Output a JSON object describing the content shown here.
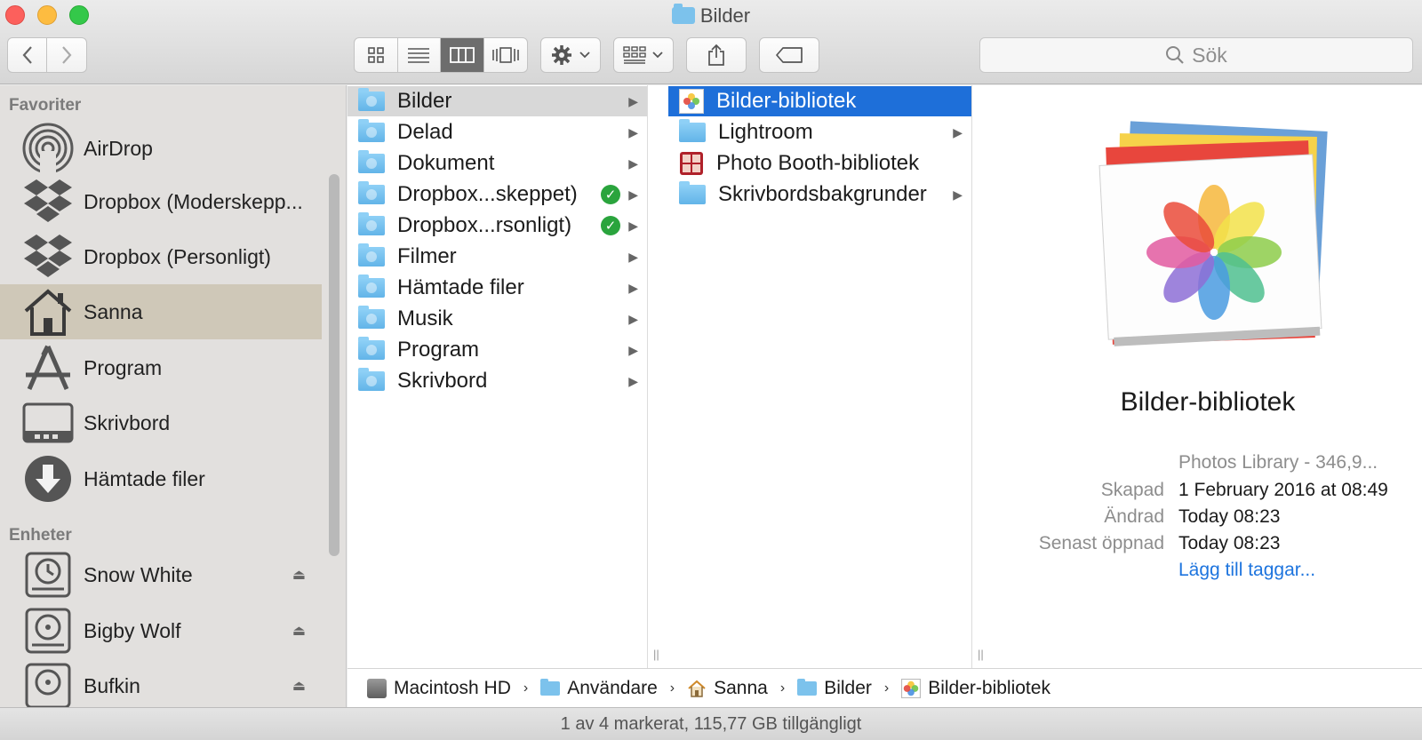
{
  "window": {
    "title": "Bilder"
  },
  "toolbar": {
    "search_placeholder": "Sök"
  },
  "sidebar": {
    "favorites_header": "Favoriter",
    "favorites": [
      {
        "label": "AirDrop",
        "icon": "airdrop-icon"
      },
      {
        "label": "Dropbox (Moderskepp...",
        "icon": "dropbox-icon"
      },
      {
        "label": "Dropbox (Personligt)",
        "icon": "dropbox-icon"
      },
      {
        "label": "Sanna",
        "icon": "home-icon",
        "selected": true
      },
      {
        "label": "Program",
        "icon": "applications-icon"
      },
      {
        "label": "Skrivbord",
        "icon": "desktop-icon"
      },
      {
        "label": "Hämtade filer",
        "icon": "downloads-icon"
      }
    ],
    "devices_header": "Enheter",
    "devices": [
      {
        "label": "Snow White",
        "icon": "time-machine-disk-icon"
      },
      {
        "label": "Bigby Wolf",
        "icon": "disk-icon"
      },
      {
        "label": "Bufkin",
        "icon": "disk-icon"
      }
    ]
  },
  "column1": [
    {
      "label": "Bilder"
    },
    {
      "label": "Delad"
    },
    {
      "label": "Dokument"
    },
    {
      "label": "Dropbox...skeppet)",
      "synced": true
    },
    {
      "label": "Dropbox...rsonligt)",
      "synced": true
    },
    {
      "label": "Filmer"
    },
    {
      "label": "Hämtade filer"
    },
    {
      "label": "Musik"
    },
    {
      "label": "Program"
    },
    {
      "label": "Skrivbord"
    }
  ],
  "column2": [
    {
      "label": "Bilder-bibliotek"
    },
    {
      "label": "Lightroom"
    },
    {
      "label": "Photo Booth-bibliotek"
    },
    {
      "label": "Skrivbordsbakgrunder"
    }
  ],
  "preview": {
    "name": "Bilder-bibliotek",
    "kind": "Photos Library - 346,9...",
    "created_label": "Skapad",
    "created": "1 February 2016 at 08:49",
    "modified_label": "Ändrad",
    "modified": "Today 08:23",
    "opened_label": "Senast öppnad",
    "opened": "Today 08:23",
    "add_tags": "Lägg till taggar..."
  },
  "pathbar": [
    "Macintosh HD",
    "Användare",
    "Sanna",
    "Bilder",
    "Bilder-bibliotek"
  ],
  "status": "1 av 4 markerat, 115,77 GB tillgängligt"
}
